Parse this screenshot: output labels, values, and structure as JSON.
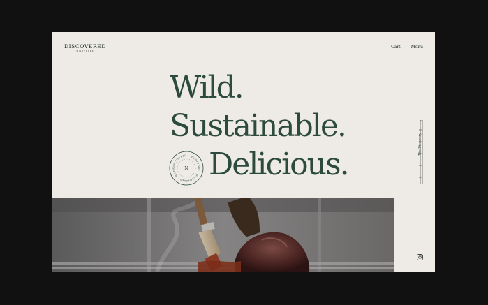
{
  "logo": {
    "wordmark": "DISCOVERED",
    "subtitle": "WILDFOODS"
  },
  "nav": {
    "cart_label": "Cart",
    "menu_label": "Menu"
  },
  "hero": {
    "line1": "Wild.",
    "line2": "Sustainable.",
    "line3": "Delicious."
  },
  "badge": {
    "center_letter": "N",
    "ring_text": "DISCOVERED · WILDFOODS · DISCOVERED · WILDFOODS ·"
  },
  "side": {
    "label": "The Discovery",
    "scroll_ticks": [
      "01",
      "02",
      "03",
      "04",
      "05"
    ]
  },
  "social": {
    "icon": "instagram-icon"
  },
  "colors": {
    "page_bg": "#111111",
    "frame_bg": "#eeebe6",
    "headline": "#2d4a3e",
    "text": "#1f2a26"
  }
}
